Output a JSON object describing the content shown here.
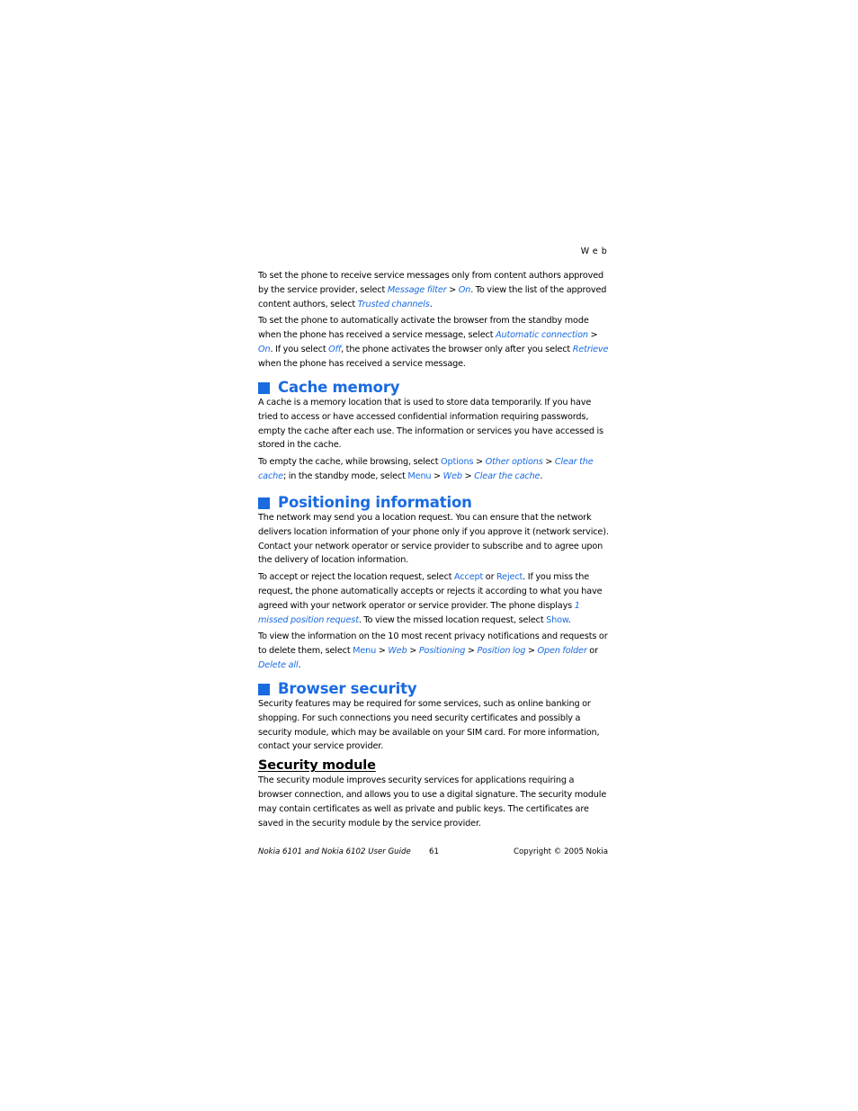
{
  "header": {
    "section": "Web"
  },
  "intro": {
    "p1": {
      "t1": "To set the phone to receive service messages only from content authors approved by the service provider, select ",
      "l1": "Message filter",
      "t2": " > ",
      "l2": "On",
      "t3": ". To view the list of the approved content authors, select ",
      "l3": "Trusted channels",
      "t4": "."
    },
    "p2": {
      "t1": "To set the phone to automatically activate the browser from the standby mode when the phone has received a service message, select ",
      "l1": "Automatic connection",
      "t2": " > ",
      "l2": "On",
      "t3": ". If you select ",
      "l3": "Off",
      "t4": ", the phone activates the browser only after you select ",
      "l4": "Retrieve",
      "t5": " when the phone has received a service message."
    }
  },
  "cache": {
    "heading": "Cache memory",
    "p1": "A cache is a memory location that is used to store data temporarily. If you have tried to access or have accessed confidential information requiring passwords, empty the cache after each use. The information or services you have accessed is stored in the cache.",
    "p2": {
      "t1": "To empty the cache, while browsing, select ",
      "l1": "Options",
      "t2": " > ",
      "l2": "Other options",
      "t3": " > ",
      "l3": "Clear the cache",
      "t4": "; in the standby mode, select ",
      "l4": "Menu",
      "t5": " > ",
      "l5": "Web",
      "t6": " > ",
      "l6": "Clear the cache",
      "t7": "."
    }
  },
  "positioning": {
    "heading": "Positioning information",
    "p1": "The network may send you a location request. You can ensure that the network delivers location information of your phone only if you approve it (network service). Contact your network operator or service provider to subscribe and to agree upon the delivery of location information.",
    "p2": {
      "t1": "To accept or reject the location request, select ",
      "l1": "Accept",
      "t2": " or ",
      "l2": "Reject",
      "t3": ". If you miss the request, the phone automatically accepts or rejects it according to what you have agreed with your network operator or service provider. The phone displays ",
      "l3": "1 missed position request",
      "t4": ". To view the missed location request, select ",
      "l4": "Show",
      "t5": "."
    },
    "p3": {
      "t1": "To view the information on the 10 most recent privacy notifications and requests or to delete them, select ",
      "l1": "Menu",
      "t2": " > ",
      "l2": "Web",
      "t3": " > ",
      "l3": "Positioning",
      "t4": " > ",
      "l4": "Position log",
      "t5": " > ",
      "l5": "Open folder",
      "t6": " or ",
      "l6": "Delete all",
      "t7": "."
    }
  },
  "security": {
    "heading": "Browser security",
    "p1": "Security features may be required for some services, such as online banking or shopping. For such connections you need security certificates and possibly a security module, which may be available on your SIM card. For more information, contact your service provider.",
    "module": {
      "heading": "Security module",
      "p1": "The security module improves security services for applications requiring a browser connection, and allows you to use a digital signature. The security module may contain certificates as well as private and public keys. The certificates are saved in the security module by the service provider."
    }
  },
  "footer": {
    "guide_title": "Nokia 6101 and Nokia 6102 User Guide",
    "page_number": "61",
    "copyright": "Copyright © 2005 Nokia"
  },
  "colors": {
    "accent": "#1a6be0",
    "text": "#000000"
  }
}
